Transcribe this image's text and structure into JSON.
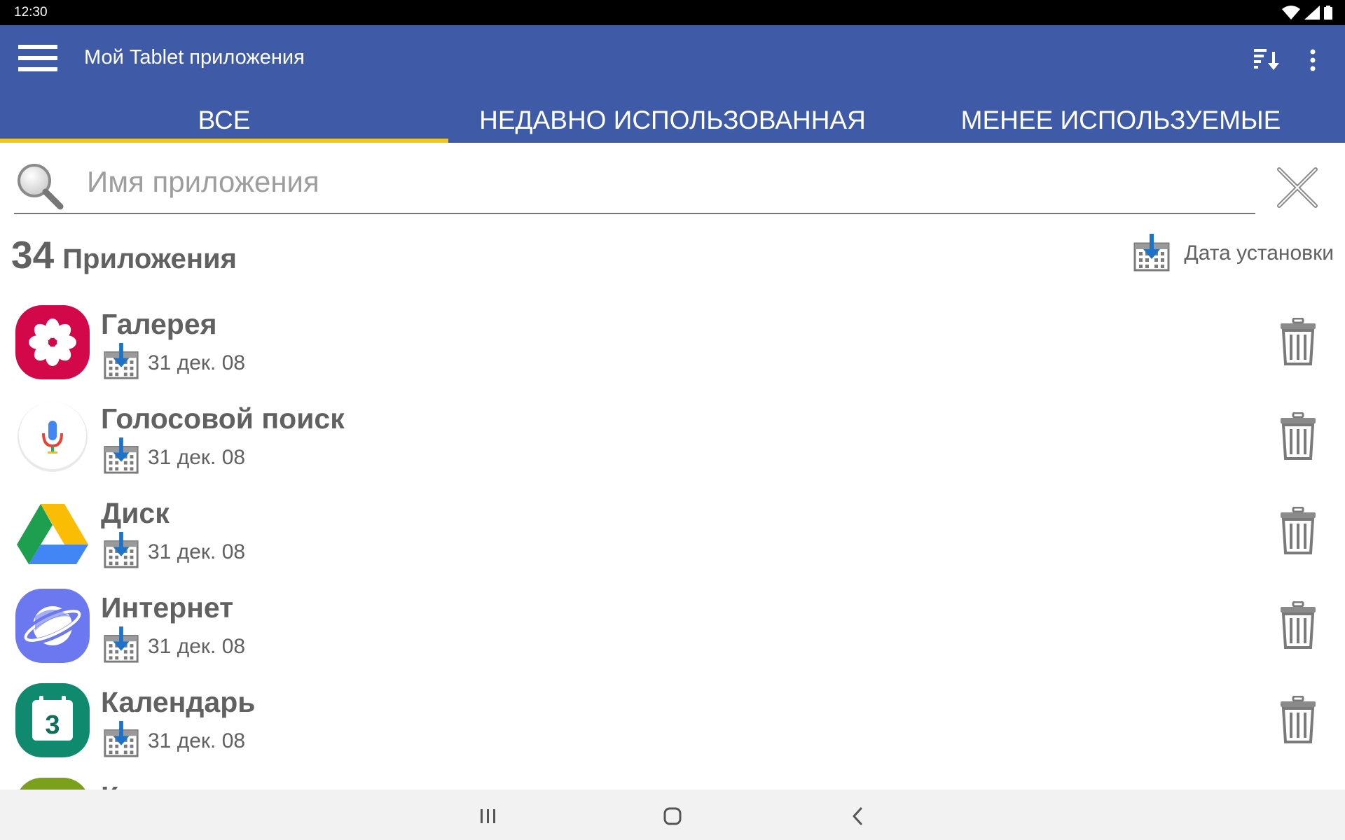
{
  "status_bar": {
    "time": "12:30",
    "icons": [
      "wifi-icon",
      "signal-icon",
      "battery-icon"
    ]
  },
  "app_bar": {
    "title": "Мой Tablet приложения",
    "menu_icon": "hamburger-menu-icon",
    "sort_icon": "sort-icon",
    "more_icon": "more-vert-icon"
  },
  "tabs": [
    {
      "label": "ВСЕ",
      "active": true
    },
    {
      "label": "НЕДАВНО ИСПОЛЬЗОВАННАЯ",
      "active": false
    },
    {
      "label": "МЕНЕЕ ИСПОЛЬЗУЕМЫЕ",
      "active": false
    }
  ],
  "search": {
    "placeholder": "Имя приложения",
    "value": ""
  },
  "summary": {
    "count": "34",
    "label": "Приложения",
    "sort_label": "Дата установки"
  },
  "apps": [
    {
      "name": "Галерея",
      "date": "31 дек. 08",
      "icon": "gallery-icon"
    },
    {
      "name": "Голосовой поиск",
      "date": "31 дек. 08",
      "icon": "voice-search-icon"
    },
    {
      "name": "Диск",
      "date": "31 дек. 08",
      "icon": "drive-icon"
    },
    {
      "name": "Интернет",
      "date": "31 дек. 08",
      "icon": "internet-icon"
    },
    {
      "name": "Календарь",
      "date": "31 дек. 08",
      "icon": "calendar-icon",
      "badge": "3"
    },
    {
      "name": "К",
      "date": "",
      "icon": "next-app-icon"
    }
  ],
  "colors": {
    "primary": "#3f5ba8",
    "accent": "#f5c518",
    "text": "#616161",
    "nav_bar": "#f2f2f2"
  },
  "nav": [
    "recents-icon",
    "home-icon",
    "back-icon"
  ]
}
